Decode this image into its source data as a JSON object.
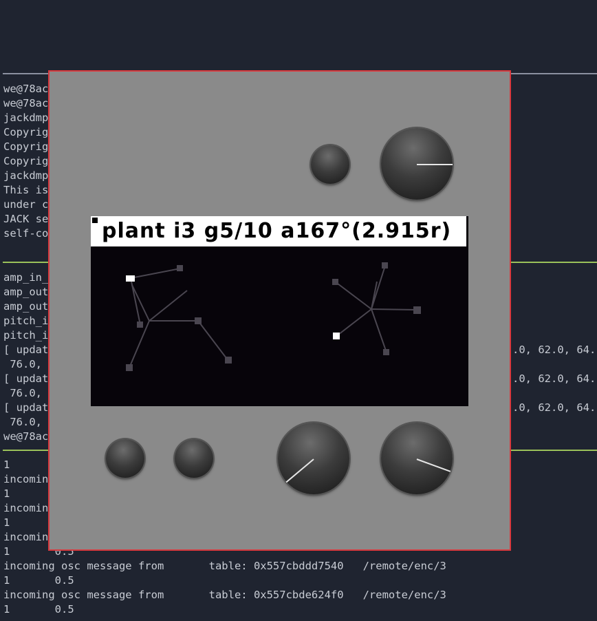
{
  "terminal": {
    "top_pane_lines": [
      "we@78ac",
      "we@78ac",
      "jackdmp",
      "Copyrig",
      "Copyrig",
      "Copyrig",
      "jackdmp",
      "This is",
      "under c",
      "JACK se",
      "self-co"
    ],
    "mid_pane_lines": [
      "amp_in_",
      "amp_out",
      "amp_out",
      "pitch_i",
      "pitch_i",
      "[ updat",
      " 76.0,",
      "[ updat",
      " 76.0,",
      "[ updat",
      " 76.0,",
      "we@78ac"
    ],
    "mid_right_fragments": [
      ".0, 62.0, 64.",
      ".0, 62.0, 64.",
      ".0, 62.0, 64."
    ],
    "bottom_pane_lines": [
      "1",
      "incomin",
      "1",
      "incomin",
      "1",
      "incomin",
      "1       0.5",
      "incoming osc message from       table: 0x557cbddd7540   /remote/enc/3",
      "1       0.5",
      "incoming osc message from       table: 0x557cbde624f0   /remote/enc/3",
      "1       0.5"
    ]
  },
  "norns": {
    "screen_title": "plant i3 g5/10 a167°(2.915r)",
    "screen_colors": {
      "background": "#07040a",
      "lines": "#4a4650",
      "points": "#ffffff"
    },
    "knobs": {
      "enc1_angle_deg": 0,
      "enc2_angle_deg": 140,
      "enc3_angle_deg": 20
    }
  }
}
